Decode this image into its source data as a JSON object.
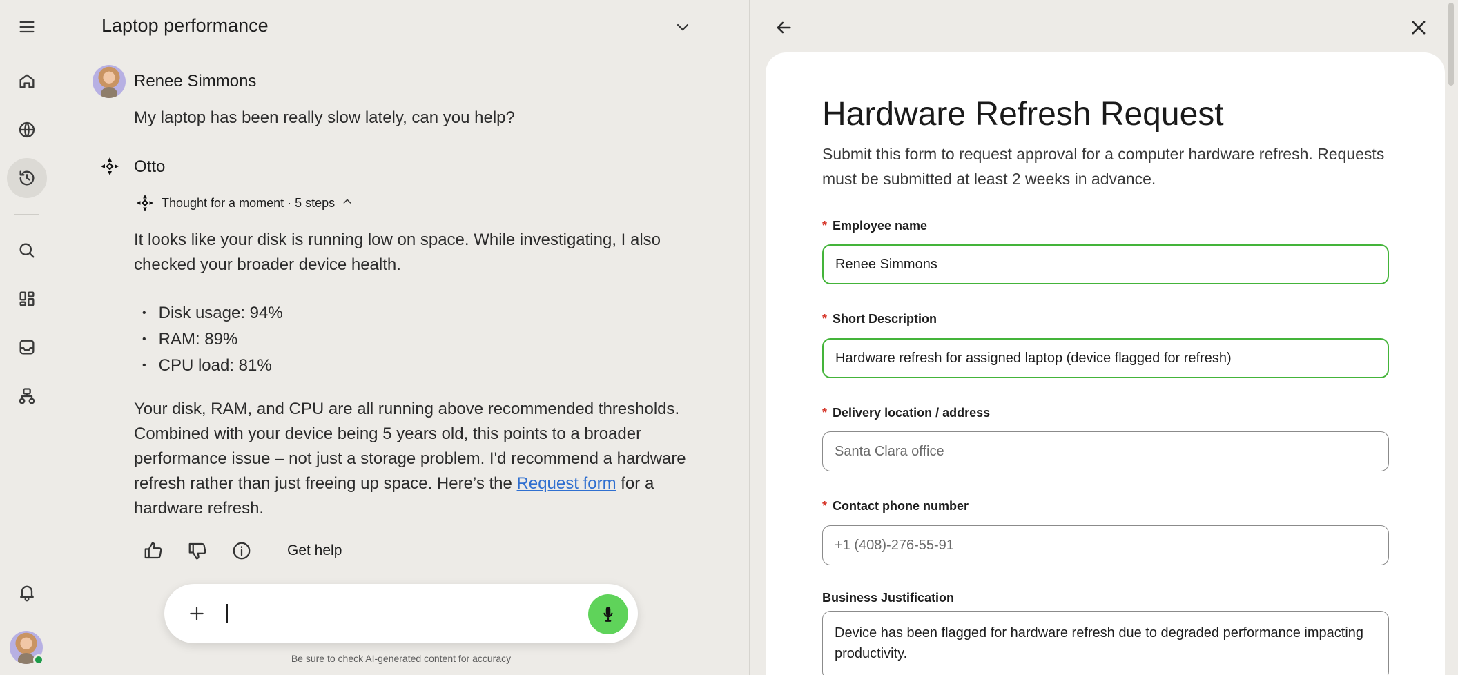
{
  "rail": {
    "items": [
      "menu-icon",
      "home-icon",
      "globe-icon",
      "history-icon",
      "search-icon",
      "grid-icon",
      "inbox-icon",
      "workflow-icon",
      "bell-icon"
    ]
  },
  "chat": {
    "title": "Laptop performance",
    "user_name": "Renee Simmons",
    "user_message": "My laptop has been really slow lately, can you help?",
    "assistant_name": "Otto",
    "thought": "Thought for a moment · 5 steps",
    "response_intro": "It looks like your disk is running low on space. While investigating, I also checked your broader device health.",
    "stats": [
      "Disk usage: 94%",
      "RAM: 89%",
      "CPU load: 81%"
    ],
    "response_body_1": "Your disk, RAM, and CPU are all running above recommended thresholds. Combined with your device being 5 years old, this points to a broader performance issue – not just a storage problem. I'd recommend a hardware refresh rather than just freeing up space. Here’s the ",
    "response_link": "Request form",
    "response_body_2": " for a hardware refresh.",
    "get_help": "Get help",
    "disclaimer": "Be sure to check AI-generated content for accuracy"
  },
  "form": {
    "title": "Hardware Refresh Request",
    "description": "Submit this form to request approval for a computer hardware refresh. Requests must be submitted at least 2 weeks in advance.",
    "required_mark": "*",
    "fields": [
      {
        "label": "Employee name",
        "value": "Renee Simmons"
      },
      {
        "label": "Short Description",
        "value": "Hardware refresh for assigned laptop (device flagged for refresh)"
      },
      {
        "label": "Delivery location / address",
        "placeholder": "Santa Clara office"
      },
      {
        "label": "Contact phone number",
        "placeholder": "+1 (408)-276-55-91"
      },
      {
        "label": "Business Justification",
        "value": "Device has been flagged for hardware refresh due to degraded performance impacting productivity."
      }
    ]
  },
  "colors": {
    "accent_green": "#44b43a",
    "mic_green": "#5fd35a",
    "link_blue": "#2f6fd0",
    "required_red": "#d6372b",
    "background": "#edebe7"
  }
}
